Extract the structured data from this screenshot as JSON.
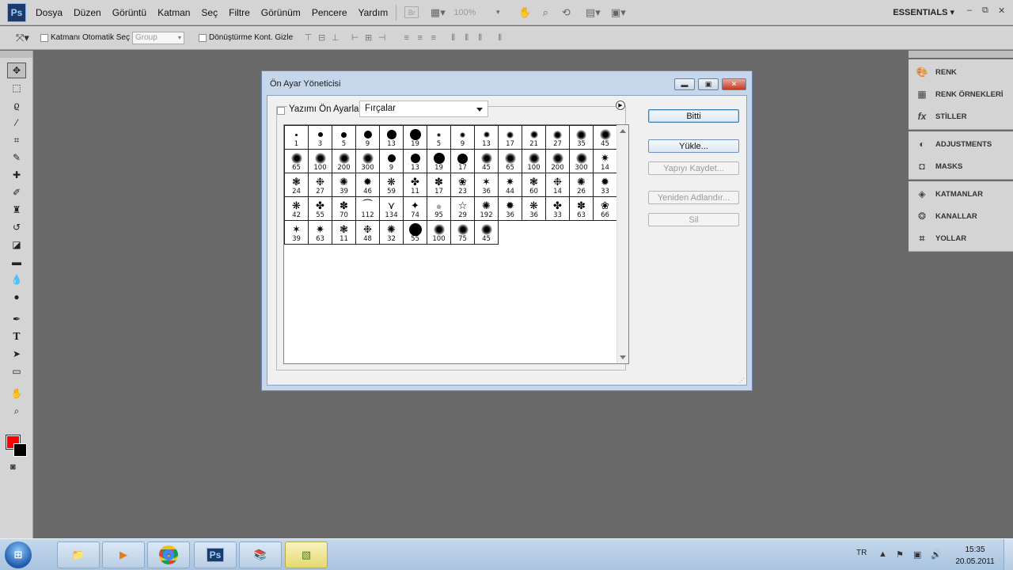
{
  "app": {
    "logo": "Ps"
  },
  "menubar": {
    "items": [
      "Dosya",
      "Düzen",
      "Görüntü",
      "Katman",
      "Seç",
      "Filtre",
      "Görünüm",
      "Pencere",
      "Yardım"
    ],
    "bridge_icon": "Br",
    "zoom": "100%",
    "workspace": "ESSENTIALS"
  },
  "options": {
    "auto_select_label": "Katmanı Otomatik Seç",
    "auto_select_value": "Group",
    "transform_label": "Dönüştürme Kont. Gizle"
  },
  "colors": {
    "foreground": "#ff0000",
    "background": "#000000"
  },
  "panels": {
    "group1": [
      "RENK",
      "RENK ÖRNEKLERİ",
      "STİLLER"
    ],
    "group2": [
      "ADJUSTMENTS",
      "MASKS"
    ],
    "group3": [
      "KATMANLAR",
      "KANALLAR",
      "YOLLAR"
    ]
  },
  "dialog": {
    "title": "Ön Ayar Yöneticisi",
    "preset_label": "Yazımı Ön Ayarla:",
    "preset_value": "Fırçalar",
    "buttons": {
      "done": "Bitti",
      "load": "Yükle...",
      "save_set": "Yapıyı Kaydet...",
      "rename": "Yeniden Adlandır...",
      "delete": "Sil"
    },
    "brush_sizes": [
      "1",
      "3",
      "5",
      "9",
      "13",
      "19",
      "5",
      "9",
      "13",
      "17",
      "21",
      "27",
      "35",
      "45",
      "65",
      "100",
      "200",
      "300",
      "9",
      "13",
      "19",
      "17",
      "45",
      "65",
      "100",
      "200",
      "300",
      "14",
      "24",
      "27",
      "39",
      "46",
      "59",
      "11",
      "17",
      "23",
      "36",
      "44",
      "60",
      "14",
      "26",
      "33",
      "42",
      "55",
      "70",
      "112",
      "134",
      "74",
      "95",
      "29",
      "192",
      "36",
      "36",
      "33",
      "63",
      "66",
      "39",
      "63",
      "11",
      "48",
      "32",
      "55",
      "100",
      "75",
      "45"
    ]
  },
  "taskbar": {
    "start_label": "⊞",
    "apps": [
      "explorer",
      "media-player",
      "chrome",
      "Ps",
      "winrar",
      "notepad"
    ],
    "lang": "TR",
    "time": "15:35",
    "date": "20.05.2011"
  }
}
